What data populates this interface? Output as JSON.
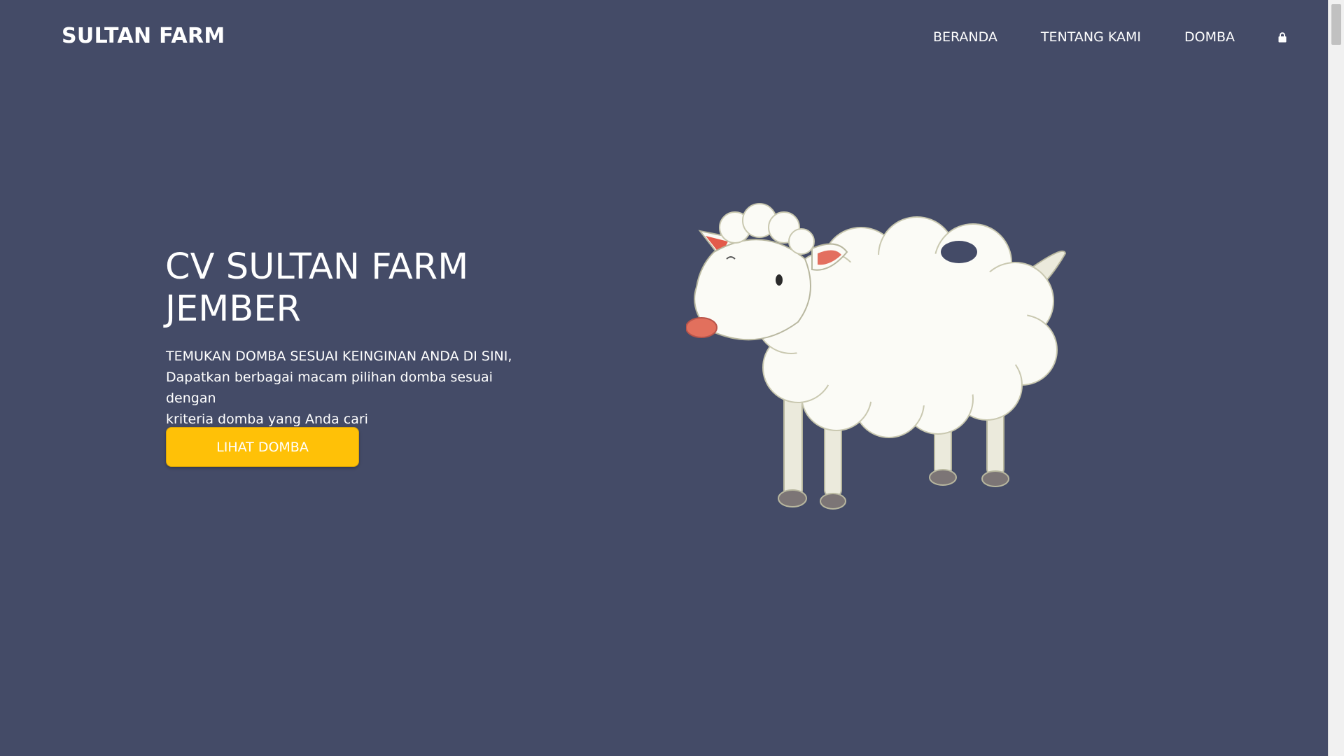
{
  "navbar": {
    "brand": "SULTAN FARM",
    "links": [
      "BERANDA",
      "TENTANG KAMI",
      "DOMBA"
    ],
    "login_icon": "lock-icon"
  },
  "hero": {
    "title_line1": "CV SULTAN FARM",
    "title_line2": "JEMBER",
    "text_line1": "TEMUKAN DOMBA SESUAI KEINGINAN ANDA DI SINI,",
    "text_line2": "Dapatkan berbagai macam pilihan domba sesuai dengan",
    "text_line3": "kriteria domba yang Anda cari",
    "button_label": "LIHAT DOMBA",
    "image": "sheep-illustration"
  },
  "colors": {
    "background": "#444b67",
    "accent": "#ffc107",
    "text": "#ffffff"
  }
}
